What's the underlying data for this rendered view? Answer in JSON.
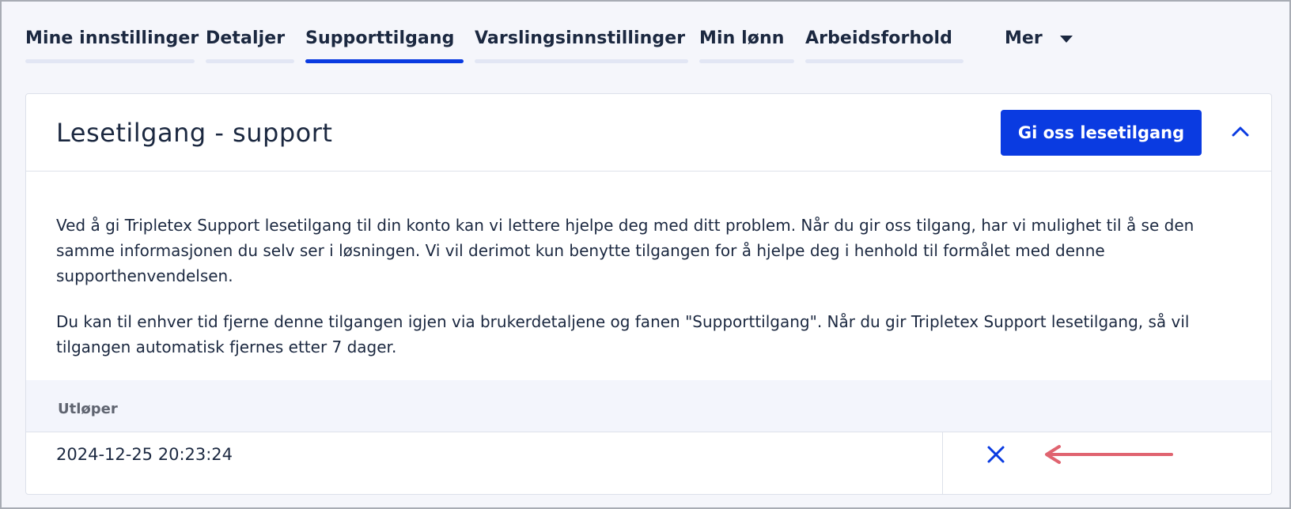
{
  "tabs": [
    {
      "label": "Mine innstillinger",
      "active": false
    },
    {
      "label": "Detaljer",
      "active": false
    },
    {
      "label": "Supporttilgang",
      "active": true
    },
    {
      "label": "Varslingsinnstillinger",
      "active": false
    },
    {
      "label": "Min lønn",
      "active": false
    },
    {
      "label": "Arbeidsforhold",
      "active": false
    }
  ],
  "more_tab": {
    "label": "Mer",
    "icon": "caret-down-icon"
  },
  "card": {
    "title": "Lesetilgang - support",
    "grant_button": "Gi oss lesetilgang",
    "collapse_icon": "chevron-up-icon",
    "paragraphs": [
      "Ved å gi Tripletex Support lesetilgang til din konto kan vi lettere hjelpe deg med ditt problem. Når du gir oss tilgang, har vi mulighet til å se den samme informasjonen du selv ser i løsningen. Vi vil derimot kun benytte tilgangen for å hjelpe deg i henhold til formålet med denne supporthenvendelsen.",
      "Du kan til enhver tid fjerne denne tilgangen igjen via brukerdetaljene og fanen \"Supporttilgang\". Når du gir Tripletex Support lesetilgang, så vil tilgangen automatisk fjernes etter 7 dager."
    ],
    "table": {
      "column_header": "Utløper",
      "rows": [
        {
          "expires": "2024-12-25 20:23:24",
          "action_icon": "close-icon"
        }
      ]
    }
  },
  "colors": {
    "accent": "#0a3be1",
    "text": "#1b2840",
    "annotation": "#e06470",
    "tab_underline": "#e2e6f4"
  }
}
